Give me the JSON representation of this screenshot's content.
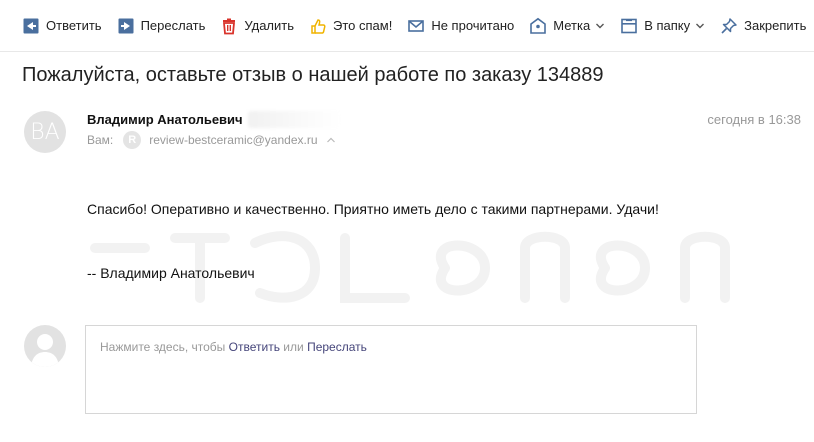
{
  "toolbar": {
    "reply": "Ответить",
    "forward": "Переслать",
    "delete": "Удалить",
    "spam": "Это спам!",
    "unread": "Не прочитано",
    "label": "Метка",
    "folder": "В папку",
    "pin": "Закрепить"
  },
  "message": {
    "subject": "Пожалуйста, оставьте отзыв о нашей работе по заказу 134889",
    "sender_name": "Владимир Анатольевич",
    "sender_initials": "BA",
    "date": "сегодня в 16:38",
    "to_label": "Вам:",
    "to_initial": "R",
    "to_email": "review-bestceramic@yandex.ru",
    "body": "Спасибо! Оперативно и качественно. Приятно иметь дело с такими партнерами. Удачи!",
    "signature": "-- Владимир Анатольевич"
  },
  "reply_box": {
    "prompt": "Нажмите здесь, чтобы",
    "reply_link": "Ответить",
    "or": "или",
    "forward_link": "Переслать"
  },
  "colors": {
    "icon_blue": "#4a6f9e",
    "icon_red": "#d9332b",
    "icon_yellow": "#f0b400",
    "link": "#45457a",
    "muted": "#999999"
  },
  "icons": [
    "reply-icon",
    "forward-icon",
    "trash-icon",
    "thumbs-up-icon",
    "envelope-icon",
    "tag-icon",
    "folder-icon",
    "pin-icon"
  ]
}
